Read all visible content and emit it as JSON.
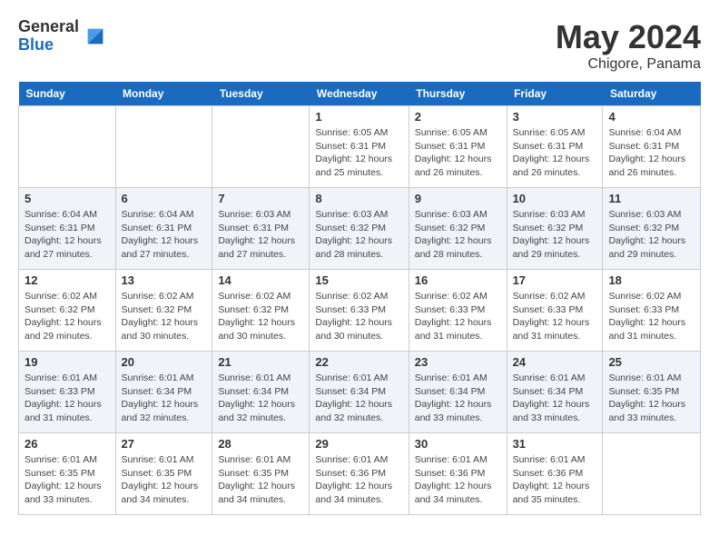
{
  "logo": {
    "general": "General",
    "blue": "Blue"
  },
  "title": {
    "month": "May 2024",
    "location": "Chigore, Panama"
  },
  "weekdays": [
    "Sunday",
    "Monday",
    "Tuesday",
    "Wednesday",
    "Thursday",
    "Friday",
    "Saturday"
  ],
  "weeks": [
    [
      {
        "day": "",
        "info": ""
      },
      {
        "day": "",
        "info": ""
      },
      {
        "day": "",
        "info": ""
      },
      {
        "day": "1",
        "info": "Sunrise: 6:05 AM\nSunset: 6:31 PM\nDaylight: 12 hours\nand 25 minutes."
      },
      {
        "day": "2",
        "info": "Sunrise: 6:05 AM\nSunset: 6:31 PM\nDaylight: 12 hours\nand 26 minutes."
      },
      {
        "day": "3",
        "info": "Sunrise: 6:05 AM\nSunset: 6:31 PM\nDaylight: 12 hours\nand 26 minutes."
      },
      {
        "day": "4",
        "info": "Sunrise: 6:04 AM\nSunset: 6:31 PM\nDaylight: 12 hours\nand 26 minutes."
      }
    ],
    [
      {
        "day": "5",
        "info": "Sunrise: 6:04 AM\nSunset: 6:31 PM\nDaylight: 12 hours\nand 27 minutes."
      },
      {
        "day": "6",
        "info": "Sunrise: 6:04 AM\nSunset: 6:31 PM\nDaylight: 12 hours\nand 27 minutes."
      },
      {
        "day": "7",
        "info": "Sunrise: 6:03 AM\nSunset: 6:31 PM\nDaylight: 12 hours\nand 27 minutes."
      },
      {
        "day": "8",
        "info": "Sunrise: 6:03 AM\nSunset: 6:32 PM\nDaylight: 12 hours\nand 28 minutes."
      },
      {
        "day": "9",
        "info": "Sunrise: 6:03 AM\nSunset: 6:32 PM\nDaylight: 12 hours\nand 28 minutes."
      },
      {
        "day": "10",
        "info": "Sunrise: 6:03 AM\nSunset: 6:32 PM\nDaylight: 12 hours\nand 29 minutes."
      },
      {
        "day": "11",
        "info": "Sunrise: 6:03 AM\nSunset: 6:32 PM\nDaylight: 12 hours\nand 29 minutes."
      }
    ],
    [
      {
        "day": "12",
        "info": "Sunrise: 6:02 AM\nSunset: 6:32 PM\nDaylight: 12 hours\nand 29 minutes."
      },
      {
        "day": "13",
        "info": "Sunrise: 6:02 AM\nSunset: 6:32 PM\nDaylight: 12 hours\nand 30 minutes."
      },
      {
        "day": "14",
        "info": "Sunrise: 6:02 AM\nSunset: 6:32 PM\nDaylight: 12 hours\nand 30 minutes."
      },
      {
        "day": "15",
        "info": "Sunrise: 6:02 AM\nSunset: 6:33 PM\nDaylight: 12 hours\nand 30 minutes."
      },
      {
        "day": "16",
        "info": "Sunrise: 6:02 AM\nSunset: 6:33 PM\nDaylight: 12 hours\nand 31 minutes."
      },
      {
        "day": "17",
        "info": "Sunrise: 6:02 AM\nSunset: 6:33 PM\nDaylight: 12 hours\nand 31 minutes."
      },
      {
        "day": "18",
        "info": "Sunrise: 6:02 AM\nSunset: 6:33 PM\nDaylight: 12 hours\nand 31 minutes."
      }
    ],
    [
      {
        "day": "19",
        "info": "Sunrise: 6:01 AM\nSunset: 6:33 PM\nDaylight: 12 hours\nand 31 minutes."
      },
      {
        "day": "20",
        "info": "Sunrise: 6:01 AM\nSunset: 6:34 PM\nDaylight: 12 hours\nand 32 minutes."
      },
      {
        "day": "21",
        "info": "Sunrise: 6:01 AM\nSunset: 6:34 PM\nDaylight: 12 hours\nand 32 minutes."
      },
      {
        "day": "22",
        "info": "Sunrise: 6:01 AM\nSunset: 6:34 PM\nDaylight: 12 hours\nand 32 minutes."
      },
      {
        "day": "23",
        "info": "Sunrise: 6:01 AM\nSunset: 6:34 PM\nDaylight: 12 hours\nand 33 minutes."
      },
      {
        "day": "24",
        "info": "Sunrise: 6:01 AM\nSunset: 6:34 PM\nDaylight: 12 hours\nand 33 minutes."
      },
      {
        "day": "25",
        "info": "Sunrise: 6:01 AM\nSunset: 6:35 PM\nDaylight: 12 hours\nand 33 minutes."
      }
    ],
    [
      {
        "day": "26",
        "info": "Sunrise: 6:01 AM\nSunset: 6:35 PM\nDaylight: 12 hours\nand 33 minutes."
      },
      {
        "day": "27",
        "info": "Sunrise: 6:01 AM\nSunset: 6:35 PM\nDaylight: 12 hours\nand 34 minutes."
      },
      {
        "day": "28",
        "info": "Sunrise: 6:01 AM\nSunset: 6:35 PM\nDaylight: 12 hours\nand 34 minutes."
      },
      {
        "day": "29",
        "info": "Sunrise: 6:01 AM\nSunset: 6:36 PM\nDaylight: 12 hours\nand 34 minutes."
      },
      {
        "day": "30",
        "info": "Sunrise: 6:01 AM\nSunset: 6:36 PM\nDaylight: 12 hours\nand 34 minutes."
      },
      {
        "day": "31",
        "info": "Sunrise: 6:01 AM\nSunset: 6:36 PM\nDaylight: 12 hours\nand 35 minutes."
      },
      {
        "day": "",
        "info": ""
      }
    ]
  ]
}
